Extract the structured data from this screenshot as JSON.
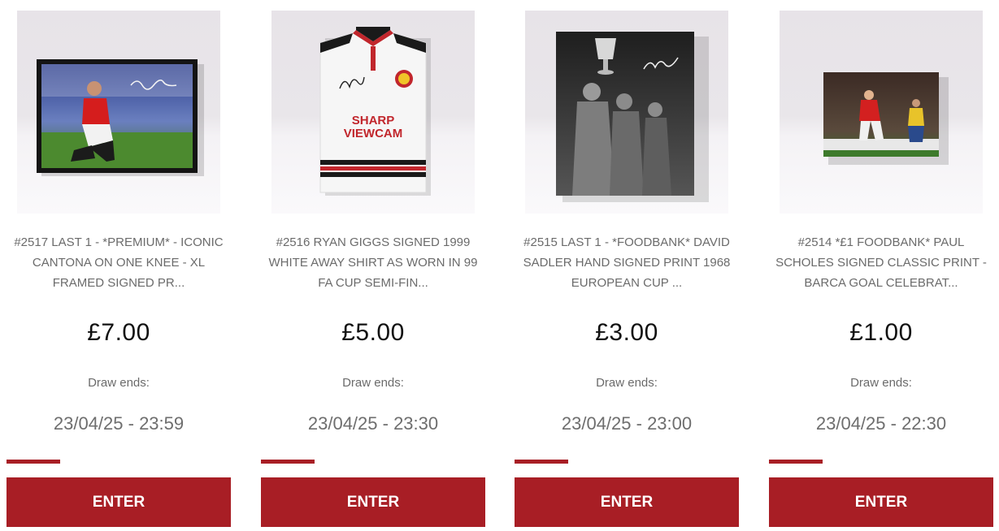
{
  "competitions": [
    {
      "title": "#2517 LAST 1 - *PREMIUM* - ICONIC CANTONA ON ONE KNEE - XL FRAMED SIGNED PR...",
      "price": "£7.00",
      "draw_label": "Draw ends:",
      "draw_date": "23/04/25 - 23:59",
      "enter_label": "ENTER",
      "sold_fraction": 0.24
    },
    {
      "title": "#2516 RYAN GIGGS SIGNED 1999 WHITE AWAY SHIRT AS WORN IN 99 FA CUP SEMI-FIN...",
      "price": "£5.00",
      "draw_label": "Draw ends:",
      "draw_date": "23/04/25 - 23:30",
      "enter_label": "ENTER",
      "sold_fraction": 0.24,
      "shirt_text": [
        "SHARP",
        "VIEWCAM"
      ]
    },
    {
      "title": "#2515 LAST 1 - *FOODBANK* DAVID SADLER HAND SIGNED PRINT 1968 EUROPEAN CUP ...",
      "price": "£3.00",
      "draw_label": "Draw ends:",
      "draw_date": "23/04/25 - 23:00",
      "enter_label": "ENTER",
      "sold_fraction": 0.24
    },
    {
      "title": "#2514 *£1 FOODBANK* PAUL SCHOLES SIGNED CLASSIC PRINT - BARCA GOAL CELEBRAT...",
      "price": "£1.00",
      "draw_label": "Draw ends:",
      "draw_date": "23/04/25 - 22:30",
      "enter_label": "ENTER",
      "sold_fraction": 0.24
    }
  ],
  "colors": {
    "accent": "#a81e25",
    "text_muted": "#6b6b6b",
    "price": "#111111"
  }
}
